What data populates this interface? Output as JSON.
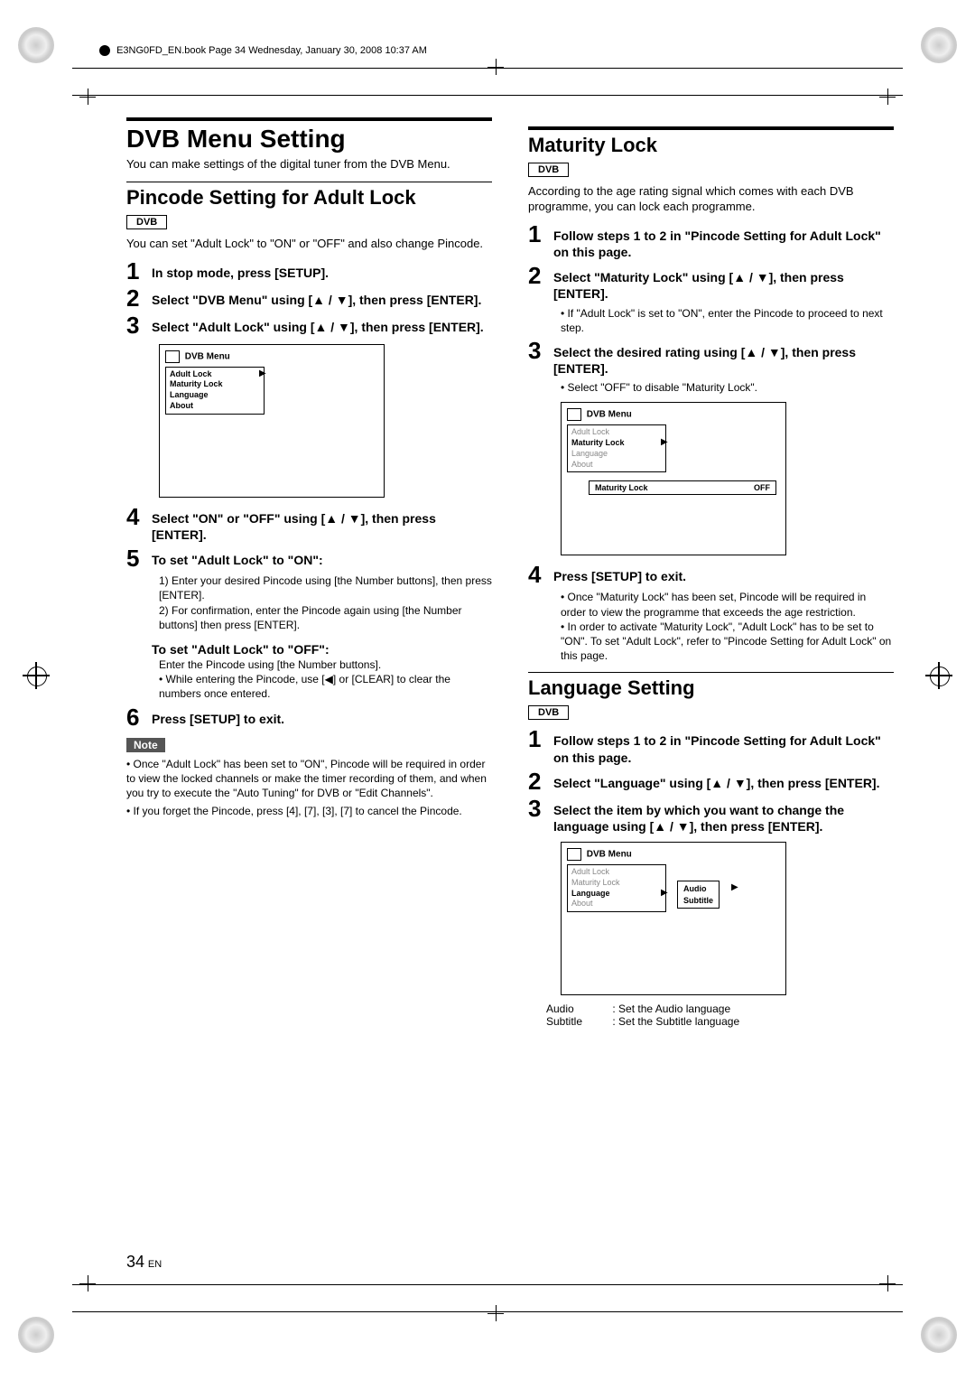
{
  "header": {
    "meta": "E3NG0FD_EN.book  Page 34  Wednesday, January 30, 2008  10:37 AM"
  },
  "page": {
    "number": "34",
    "lang": "EN"
  },
  "col1": {
    "h1": "DVB Menu Setting",
    "intro": "You can make settings of the digital tuner from the DVB Menu.",
    "pincode": {
      "h2": "Pincode Setting for Adult Lock",
      "tag": "DVB",
      "desc": "You can set \"Adult Lock\" to \"ON\" or \"OFF\" and also change Pincode.",
      "s1": "In stop mode, press [SETUP].",
      "s2": "Select \"DVB Menu\" using [▲ / ▼], then press [ENTER].",
      "s3": "Select \"Adult Lock\" using [▲ / ▼], then press [ENTER].",
      "screen": {
        "title": "DVB Menu",
        "items": [
          "Adult Lock",
          "Maturity Lock",
          "Language",
          "About"
        ]
      },
      "s4": "Select \"ON\" or \"OFF\" using [▲ / ▼], then press [ENTER].",
      "s5title": "To set \"Adult Lock\" to \"ON\":",
      "s5a": "1) Enter your desired Pincode using [the Number buttons], then press [ENTER].",
      "s5b": "2) For confirmation, enter the Pincode again using [the Number buttons] then press [ENTER].",
      "s5offtitle": "To set \"Adult Lock\" to \"OFF\":",
      "s5off": "Enter the Pincode using [the Number buttons].",
      "s5bullet": "• While entering the Pincode, use [◀] or [CLEAR] to clear the numbers once entered.",
      "s6": "Press [SETUP] to exit.",
      "noteLabel": "Note",
      "note1": "• Once \"Adult Lock\" has been set to \"ON\", Pincode will be required in order to view the locked channels or make the timer recording of them, and when you try to execute the \"Auto Tuning\" for DVB or \"Edit Channels\".",
      "note2": "• If you forget the Pincode, press [4], [7], [3], [7] to cancel the Pincode."
    }
  },
  "col2": {
    "maturity": {
      "h2": "Maturity Lock",
      "tag": "DVB",
      "desc": "According to the age rating signal which comes with each DVB programme, you can lock each programme.",
      "s1": "Follow steps 1 to 2 in \"Pincode Setting for Adult Lock\" on this page.",
      "s2": "Select \"Maturity Lock\" using [▲ / ▼], then press [ENTER].",
      "s2note": "• If \"Adult Lock\" is set to \"ON\", enter the Pincode to proceed to next step.",
      "s3": "Select the desired rating using [▲ / ▼], then press [ENTER].",
      "s3note": "• Select \"OFF\" to disable \"Maturity Lock\".",
      "screen": {
        "title": "DVB Menu",
        "items": [
          "Adult Lock",
          "Maturity Lock",
          "Language",
          "About"
        ],
        "rowLabel": "Maturity Lock",
        "rowValue": "OFF"
      },
      "s4": "Press [SETUP] to exit.",
      "s4note1": "• Once \"Maturity Lock\" has been set, Pincode will be required in order to view the programme that exceeds the age restriction.",
      "s4note2": "• In order to activate \"Maturity Lock\", \"Adult Lock\" has to be set to \"ON\". To set \"Adult Lock\", refer to \"Pincode Setting for Adult Lock\" on this page."
    },
    "lang": {
      "h2": "Language Setting",
      "tag": "DVB",
      "s1": "Follow steps 1 to 2 in \"Pincode Setting for Adult Lock\" on this page.",
      "s2": "Select \"Language\" using [▲ / ▼], then press [ENTER].",
      "s3": "Select the item by which you want to change the language using [▲ / ▼], then press [ENTER].",
      "screen": {
        "title": "DVB Menu",
        "items": [
          "Adult Lock",
          "Maturity Lock",
          "Language",
          "About"
        ],
        "sub": [
          "Audio",
          "Subtitle"
        ]
      },
      "tblAudioLabel": "Audio",
      "tblAudioDesc": ": Set the Audio language",
      "tblSubLabel": "Subtitle",
      "tblSubDesc": ": Set the Subtitle language"
    }
  }
}
